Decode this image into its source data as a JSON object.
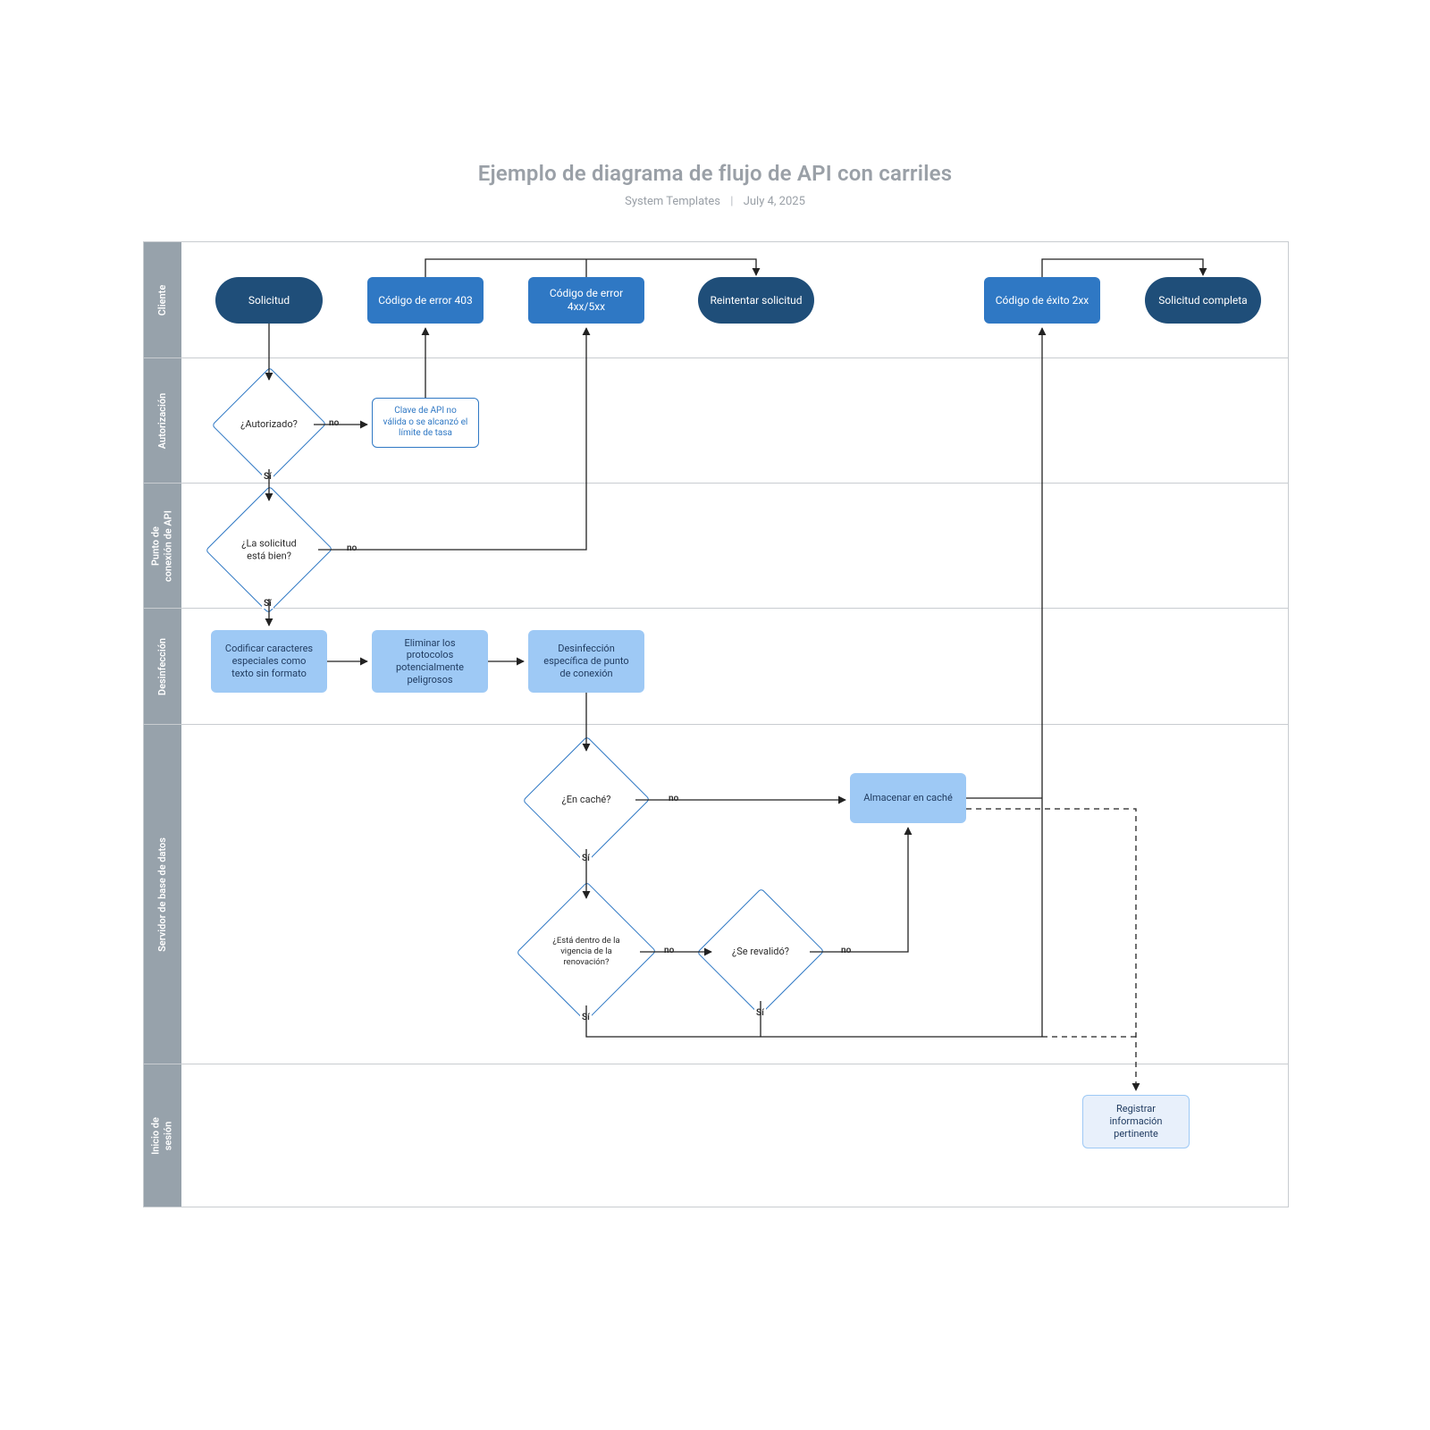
{
  "header": {
    "title": "Ejemplo de diagrama de flujo de API con carriles",
    "author": "System Templates",
    "date": "July 4, 2025"
  },
  "lanes": {
    "client": "Cliente",
    "auth": "Autorización",
    "endpoint": "Punto de\nconexión de API",
    "sanitize": "Desinfección",
    "db": "Servidor de base de datos",
    "login": "Inicio de\nsesión"
  },
  "nodes": {
    "request": "Solicitud",
    "err403": "Código de error 403",
    "err4xx5xx": "Código de error 4xx/5xx",
    "retry": "Reintentar solicitud",
    "success2xx": "Código de éxito 2xx",
    "complete": "Solicitud completa",
    "authorized_q": "¿Autorizado?",
    "api_key_info": "Clave de API no válida o se alcanzó el límite de tasa",
    "request_ok_q": "¿La solicitud está bien?",
    "encode": "Codificar caracteres especiales como texto sin formato",
    "strip": "Eliminar los protocolos potencialmente peligrosos",
    "endpoint_sanitize": "Desinfección específica de punto de conexión",
    "cached_q": "¿En caché?",
    "store_cache": "Almacenar en caché",
    "within_renew_q": "¿Está dentro de la vigencia de la renovación?",
    "revalidated_q": "¿Se revalidó?",
    "log_info": "Registrar información pertinente"
  },
  "labels": {
    "yes": "Sí",
    "no": "no"
  }
}
